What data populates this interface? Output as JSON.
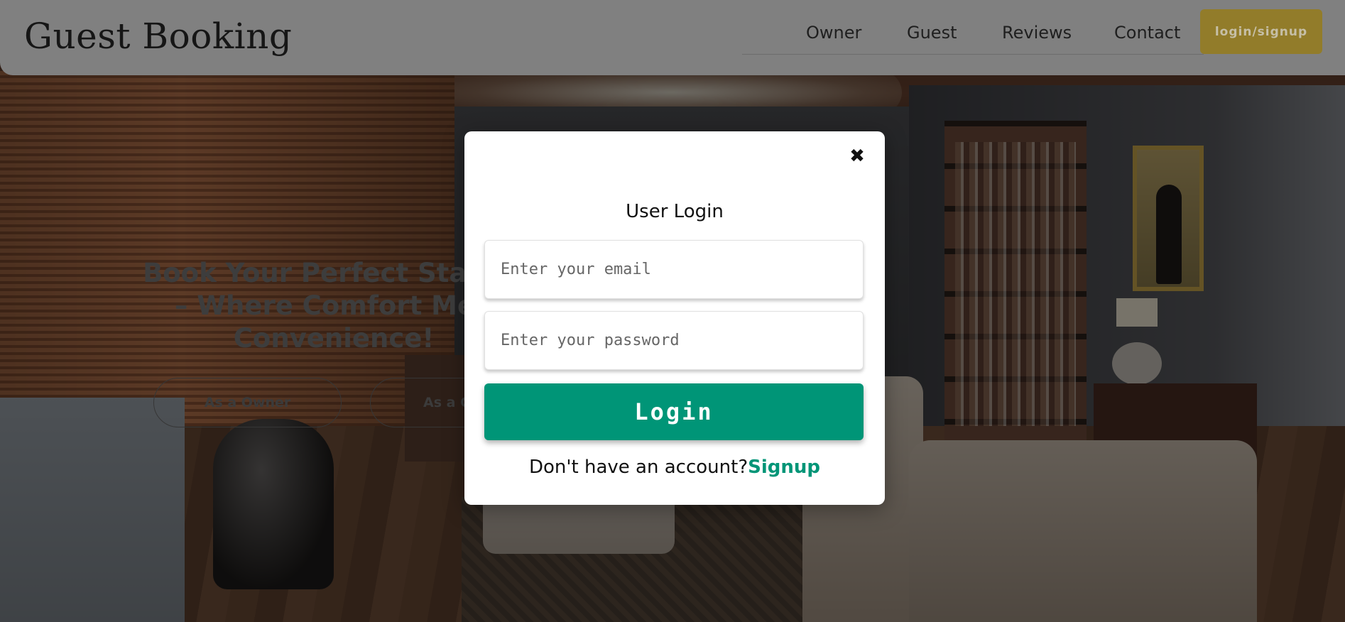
{
  "header": {
    "brand": "Guest Booking",
    "nav": [
      "Owner",
      "Guest",
      "Reviews",
      "Contact"
    ],
    "login_signup_label": "login/signup"
  },
  "hero": {
    "title_line1": "Book Your Perfect Stay To",
    "title_line2": "– Where Comfort Mee",
    "title_line3": "Convenience!",
    "owner_button": "As a Owner",
    "guest_button": "As a G"
  },
  "modal": {
    "close_glyph": "✖",
    "title": "User Login",
    "email_placeholder": "Enter your email",
    "password_placeholder": "Enter your password",
    "login_label": "Login",
    "signup_prompt": "Don't have an account?",
    "signup_link": "Signup"
  },
  "colors": {
    "accent": "#009577",
    "header_button": "#927c2a"
  }
}
